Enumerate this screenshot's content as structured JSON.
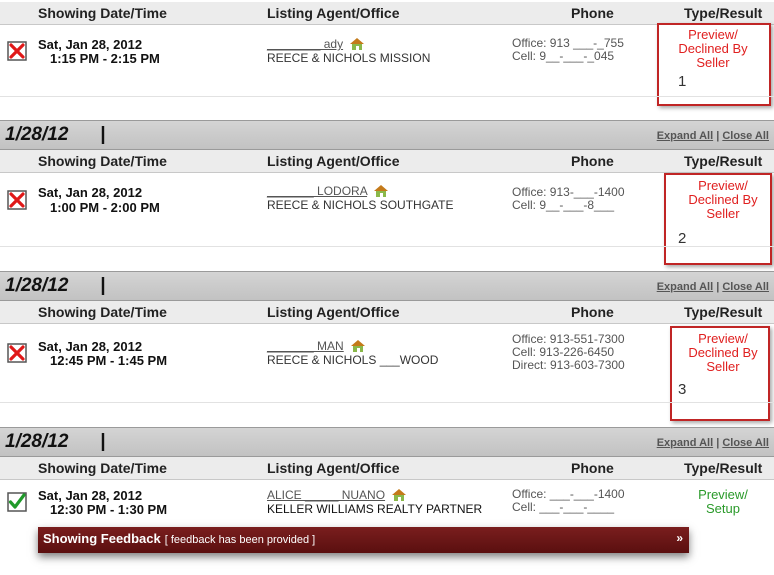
{
  "columns": {
    "date": "Showing Date/Time",
    "agent": "Listing Agent/Office",
    "phone": "Phone",
    "type": "Type/Result"
  },
  "group_links": {
    "expand": "Expand All",
    "sep": "|",
    "close": "Close All"
  },
  "group_sep": "|",
  "groups": [
    {
      "date": "",
      "address": "",
      "showing": {
        "date": "Sat, Jan 28, 2012",
        "time": "1:15 PM - 2:15 PM",
        "agent_name": "________ ady",
        "office": "REECE & NICHOLS MISSION",
        "phones": [
          "Office: 913 ___-_755",
          "Cell: 9__-___-_045"
        ],
        "result_line1": "Preview/",
        "result_line2": "Declined By",
        "result_line3": "Seller",
        "status": "declined",
        "highlight": "1"
      }
    },
    {
      "date": "1/28/12",
      "address": "",
      "showing": {
        "date": "Sat, Jan 28, 2012",
        "time": "1:00 PM - 2:00 PM",
        "agent_name": "_______ LODORA",
        "office": "REECE & NICHOLS SOUTHGATE",
        "phones": [
          "Office: 913-___-1400",
          "Cell: 9__-___-8___"
        ],
        "result_line1": "Preview/",
        "result_line2": "Declined By",
        "result_line3": "Seller",
        "status": "declined",
        "highlight": "2"
      }
    },
    {
      "date": "1/28/12",
      "address": "",
      "showing": {
        "date": "Sat, Jan 28, 2012",
        "time": "12:45 PM - 1:45 PM",
        "agent_name": "_______ MAN",
        "office": "REECE & NICHOLS ___WOOD",
        "phones": [
          "Office: 913-551-7300",
          "Cell: 913-226-6450",
          "Direct: 913-603-7300"
        ],
        "result_line1": "Preview/",
        "result_line2": "Declined By",
        "result_line3": "Seller",
        "status": "declined",
        "highlight": "3"
      }
    },
    {
      "date": "1/28/12",
      "address": "",
      "showing": {
        "date": "Sat, Jan 28, 2012",
        "time": "12:30 PM - 1:30 PM",
        "agent_name": "ALICE _____ NUANO",
        "office": "KELLER WILLIAMS REALTY PARTNER",
        "phones": [
          "Office: ___-___-1400",
          "Cell: ___-___-____"
        ],
        "result_line1": "Preview/",
        "result_line2": "Setup",
        "result_line3": "",
        "status": "setup",
        "highlight": ""
      }
    }
  ],
  "feedback": {
    "title": "Showing Feedback",
    "note": "[ feedback has been provided ]",
    "chevron": "»"
  },
  "colors": {
    "declined": "#e02020",
    "setup": "#2a9a2a",
    "feedback_bar": "#6b1515",
    "highlight": "#c02525"
  },
  "icons": {
    "declined": "red-x-icon",
    "setup": "green-check-icon",
    "agent": "house-icon",
    "expand": "double-chevron-down-icon"
  }
}
